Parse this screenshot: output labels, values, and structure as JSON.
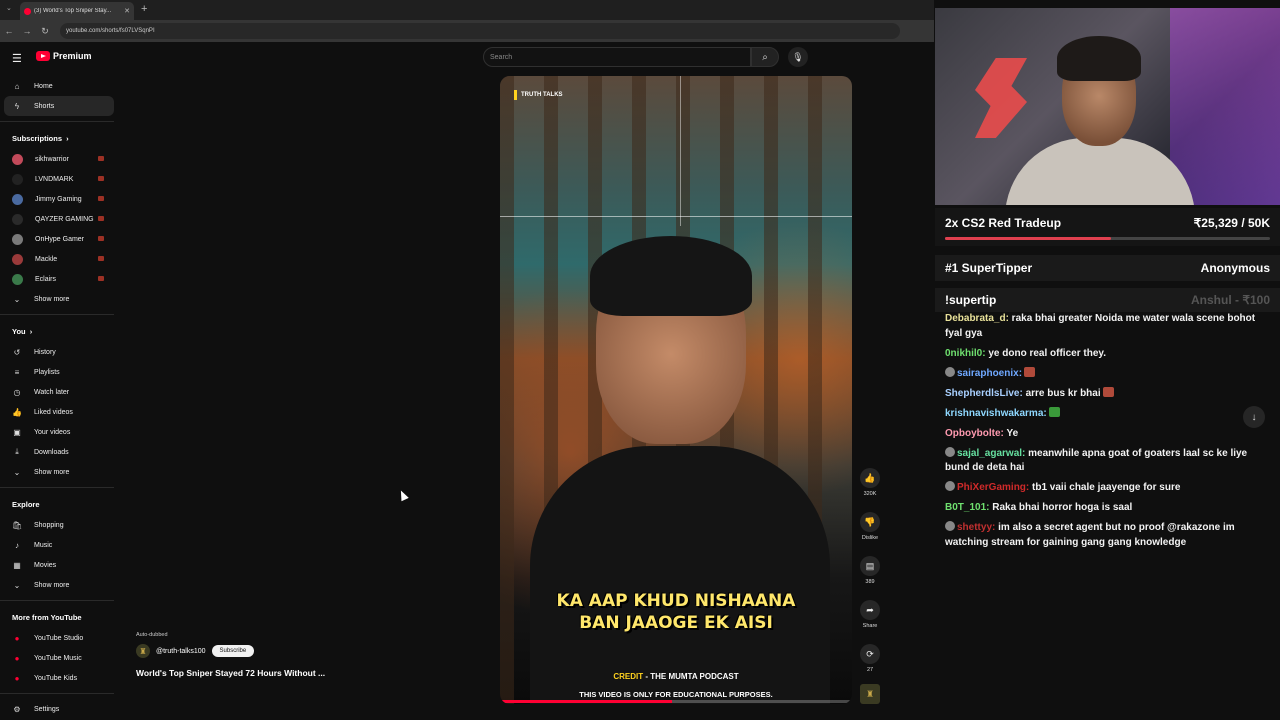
{
  "browser": {
    "tab_title": "(3) World's Top Sniper Stay...",
    "url": "youtube.com/shorts/fs07LVSqnPI"
  },
  "youtube": {
    "brand": "Premium",
    "search_placeholder": "Search",
    "nav": [
      {
        "label": "Home",
        "icon": "home-icon"
      },
      {
        "label": "Shorts",
        "icon": "shorts-icon"
      }
    ],
    "subscriptions_title": "Subscriptions",
    "subscriptions": [
      {
        "label": "sikhwarrior",
        "color": "#c24a5a"
      },
      {
        "label": "LVNDMARK",
        "color": "#222222"
      },
      {
        "label": "Jimmy Gaming",
        "color": "#4a6aa0"
      },
      {
        "label": "QAYZER GAMING",
        "color": "#2a2a2a"
      },
      {
        "label": "OnHype Gamer",
        "color": "#7a7a7a"
      },
      {
        "label": "Mackle",
        "color": "#9a3a3a"
      },
      {
        "label": "Eclairs",
        "color": "#3a7a4a"
      }
    ],
    "show_more": "Show more",
    "you_title": "You",
    "you_items": [
      {
        "label": "History",
        "icon": "history-icon"
      },
      {
        "label": "Playlists",
        "icon": "playlists-icon"
      },
      {
        "label": "Watch later",
        "icon": "watch-later-icon"
      },
      {
        "label": "Liked videos",
        "icon": "like-icon"
      },
      {
        "label": "Your videos",
        "icon": "your-videos-icon"
      },
      {
        "label": "Downloads",
        "icon": "download-icon"
      }
    ],
    "explore_title": "Explore",
    "explore_items": [
      {
        "label": "Shopping",
        "icon": "shopping-icon"
      },
      {
        "label": "Music",
        "icon": "music-icon"
      },
      {
        "label": "Movies",
        "icon": "movies-icon"
      }
    ],
    "more_title": "More from YouTube",
    "more_items": [
      {
        "label": "YouTube Studio"
      },
      {
        "label": "YouTube Music"
      },
      {
        "label": "YouTube Kids"
      }
    ],
    "settings": "Settings"
  },
  "short": {
    "brand": "TRUTH TALKS",
    "subtitle_line1": "KA AAP KHUD NISHAANA",
    "subtitle_line2": "BAN JAAOGE EK AISI",
    "credit_label": "CREDIT",
    "credit_text": " - THE MUMTA PODCAST",
    "note": "THIS VIDEO IS ONLY FOR EDUCATIONAL PURPOSES.",
    "progress": 0.49,
    "likes": "320K",
    "dislike": "Dislike",
    "comments": "389",
    "share": "Share",
    "remix": "27",
    "auto_dubbed": "Auto-dubbed",
    "channel": "@truth-talks100",
    "subscribe": "Subscribe",
    "title": "World's Top Sniper Stayed 72 Hours Without ..."
  },
  "stream": {
    "goal_label": "2x CS2 Red Tradeup",
    "goal_value": "₹25,329 / 50K",
    "goal_progress": 0.51,
    "supertipper_label": "#1 SuperTipper",
    "supertipper_value": "Anonymous",
    "command_label": "!supertip",
    "command_value": "Anshul - ₹100",
    "chat": [
      {
        "user": "Debabrata_d:",
        "color": "#e9e29a",
        "text": " raka bhai greater Noida me water wala scene bohot fyal gya"
      },
      {
        "user": "0nikhil0:",
        "color": "#6fe06f",
        "text": " ye dono real officer they."
      },
      {
        "user": "sairaphoenix:",
        "color": "#6fa8ff",
        "text": "",
        "badge": true,
        "emote": "#b04a3a"
      },
      {
        "user": "ShepherdlsLive:",
        "color": "#a9d0ff",
        "text": " arre bus kr bhai",
        "emote": "#b04a3a"
      },
      {
        "user": "krishnavishwakarma:",
        "color": "#8fd8ff",
        "text": "",
        "emote": "#3a9a3a"
      },
      {
        "user": "Opboybolte:",
        "color": "#ff9ab0",
        "text": " Ye"
      },
      {
        "user": "sajal_agarwal:",
        "color": "#66e0a0",
        "text": " meanwhile apna goat of goaters laal sc ke liye bund de deta hai",
        "badge": true
      },
      {
        "user": "PhiXerGaming:",
        "color": "#d02a2a",
        "text": " tb1 vaii chale jaayenge for sure",
        "badge": true
      },
      {
        "user": "B0T_101:",
        "color": "#6fe06f",
        "text": " Raka bhai horror hoga is saal"
      },
      {
        "user": "shettyy:",
        "color": "#c03030",
        "text": " im also a secret agent but no proof @rakazone im watching stream for gaining gang gang knowledge",
        "badge": true
      }
    ]
  }
}
